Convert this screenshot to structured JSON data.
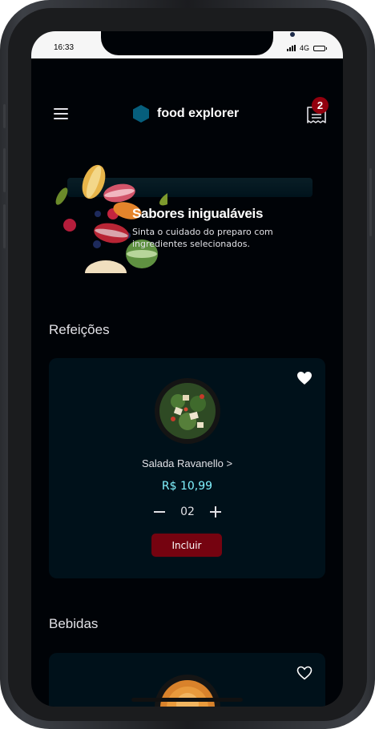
{
  "status_bar": {
    "time": "16:33",
    "network": "4G"
  },
  "header": {
    "brand_name": "food explorer",
    "cart_count": "2",
    "icons": [
      "menu-icon",
      "hexagon-logo-icon",
      "receipt-icon"
    ]
  },
  "banner": {
    "title": "Sabores inigualáveis",
    "subtitle": "Sinta o cuidado do preparo com ingredientes selecionados."
  },
  "sections": [
    {
      "title": "Refeições",
      "dishes": [
        {
          "name": "Salada Ravanello >",
          "price": "R$ 10,99",
          "quantity": "02",
          "add_label": "Incluir",
          "favorite": true
        }
      ]
    },
    {
      "title": "Bebidas",
      "dishes": [
        {
          "favorite": false
        }
      ]
    }
  ],
  "colors": {
    "background": "#000307",
    "card": "#00111a",
    "price": "#82f3ff",
    "button": "#750310",
    "badge": "#92000e",
    "logo": "#065e7c"
  }
}
